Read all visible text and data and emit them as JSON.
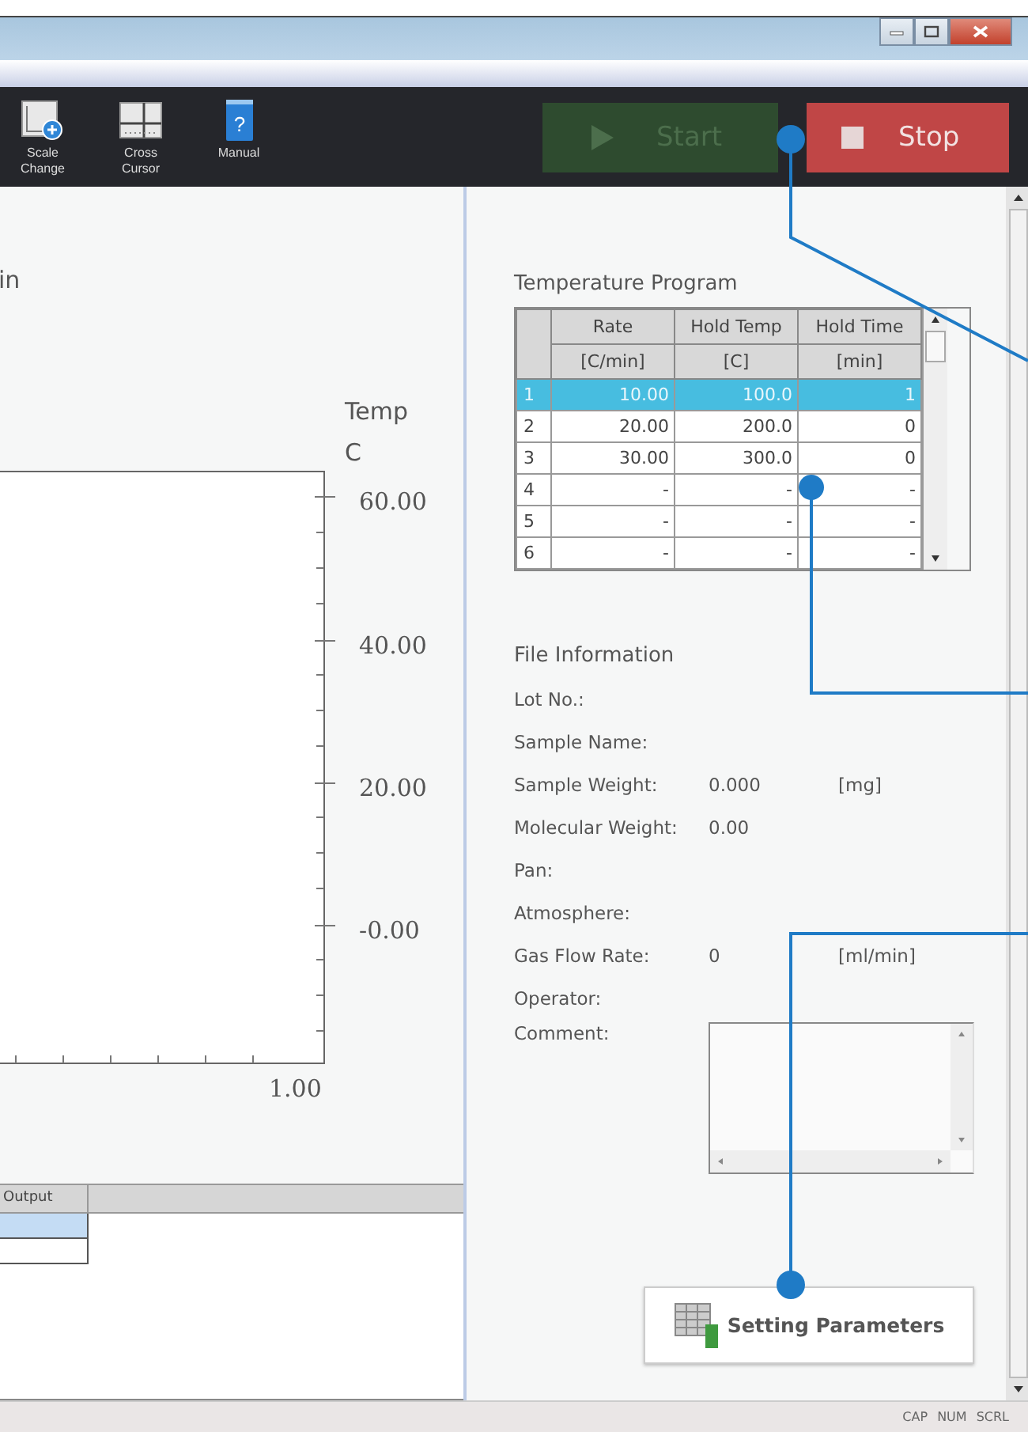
{
  "toolbar": {
    "tools": [
      {
        "kind": "scale",
        "label_lines": [
          "Scale",
          "Change"
        ]
      },
      {
        "kind": "cursor",
        "label_lines": [
          "Cross",
          "Cursor"
        ]
      },
      {
        "kind": "manual",
        "icon_glyph": "?",
        "label_lines": [
          "Manual"
        ]
      }
    ],
    "start_button": {
      "label": "Start",
      "disabled": true
    },
    "stop_button": {
      "label": "Stop",
      "disabled": false
    }
  },
  "graph": {
    "x_unit_fragment": "in",
    "y_title": "Temp",
    "y_unit": "C",
    "y_ticks": [
      "60.00",
      "40.00",
      "20.00",
      "-0.00"
    ],
    "x_tick": "1.00"
  },
  "output_table": {
    "columns": [
      "Output"
    ],
    "rows": [
      {
        "selected": true
      },
      {
        "selected": false
      }
    ]
  },
  "temperature_program": {
    "title": "Temperature Program",
    "columns": [
      {
        "name": "Rate",
        "unit": "[C/min]"
      },
      {
        "name": "Hold Temp",
        "unit": "[C]"
      },
      {
        "name": "Hold Time",
        "unit": "[min]"
      }
    ],
    "rows": [
      {
        "index": "1",
        "cells": [
          "10.00",
          "100.0",
          "1"
        ],
        "selected": true
      },
      {
        "index": "2",
        "cells": [
          "20.00",
          "200.0",
          "0"
        ],
        "selected": false
      },
      {
        "index": "3",
        "cells": [
          "30.00",
          "300.0",
          "0"
        ],
        "selected": false
      },
      {
        "index": "4",
        "cells": [
          "-",
          "-",
          "-"
        ],
        "selected": false
      },
      {
        "index": "5",
        "cells": [
          "-",
          "-",
          "-"
        ],
        "selected": false
      },
      {
        "index": "6",
        "cells": [
          "-",
          "-",
          "-"
        ],
        "selected": false
      }
    ]
  },
  "file_information": {
    "title": "File Information",
    "fields": [
      {
        "label": "Lot No.:"
      },
      {
        "label": "Sample Name:"
      },
      {
        "label": "Sample Weight:",
        "value": "0.000",
        "unit": "[mg]"
      },
      {
        "label": "Molecular Weight:",
        "value": "0.00"
      },
      {
        "label": "Pan:"
      },
      {
        "label": "Atmosphere:"
      },
      {
        "label": "Gas Flow Rate:",
        "value": "0",
        "unit": "[ml/min]"
      },
      {
        "label": "Operator:"
      }
    ],
    "comment_label": "Comment:"
  },
  "setting_parameters_button": {
    "label": "Setting Parameters"
  },
  "status_bar": {
    "indicators": [
      "CAP",
      "NUM",
      "SCRL"
    ]
  }
}
